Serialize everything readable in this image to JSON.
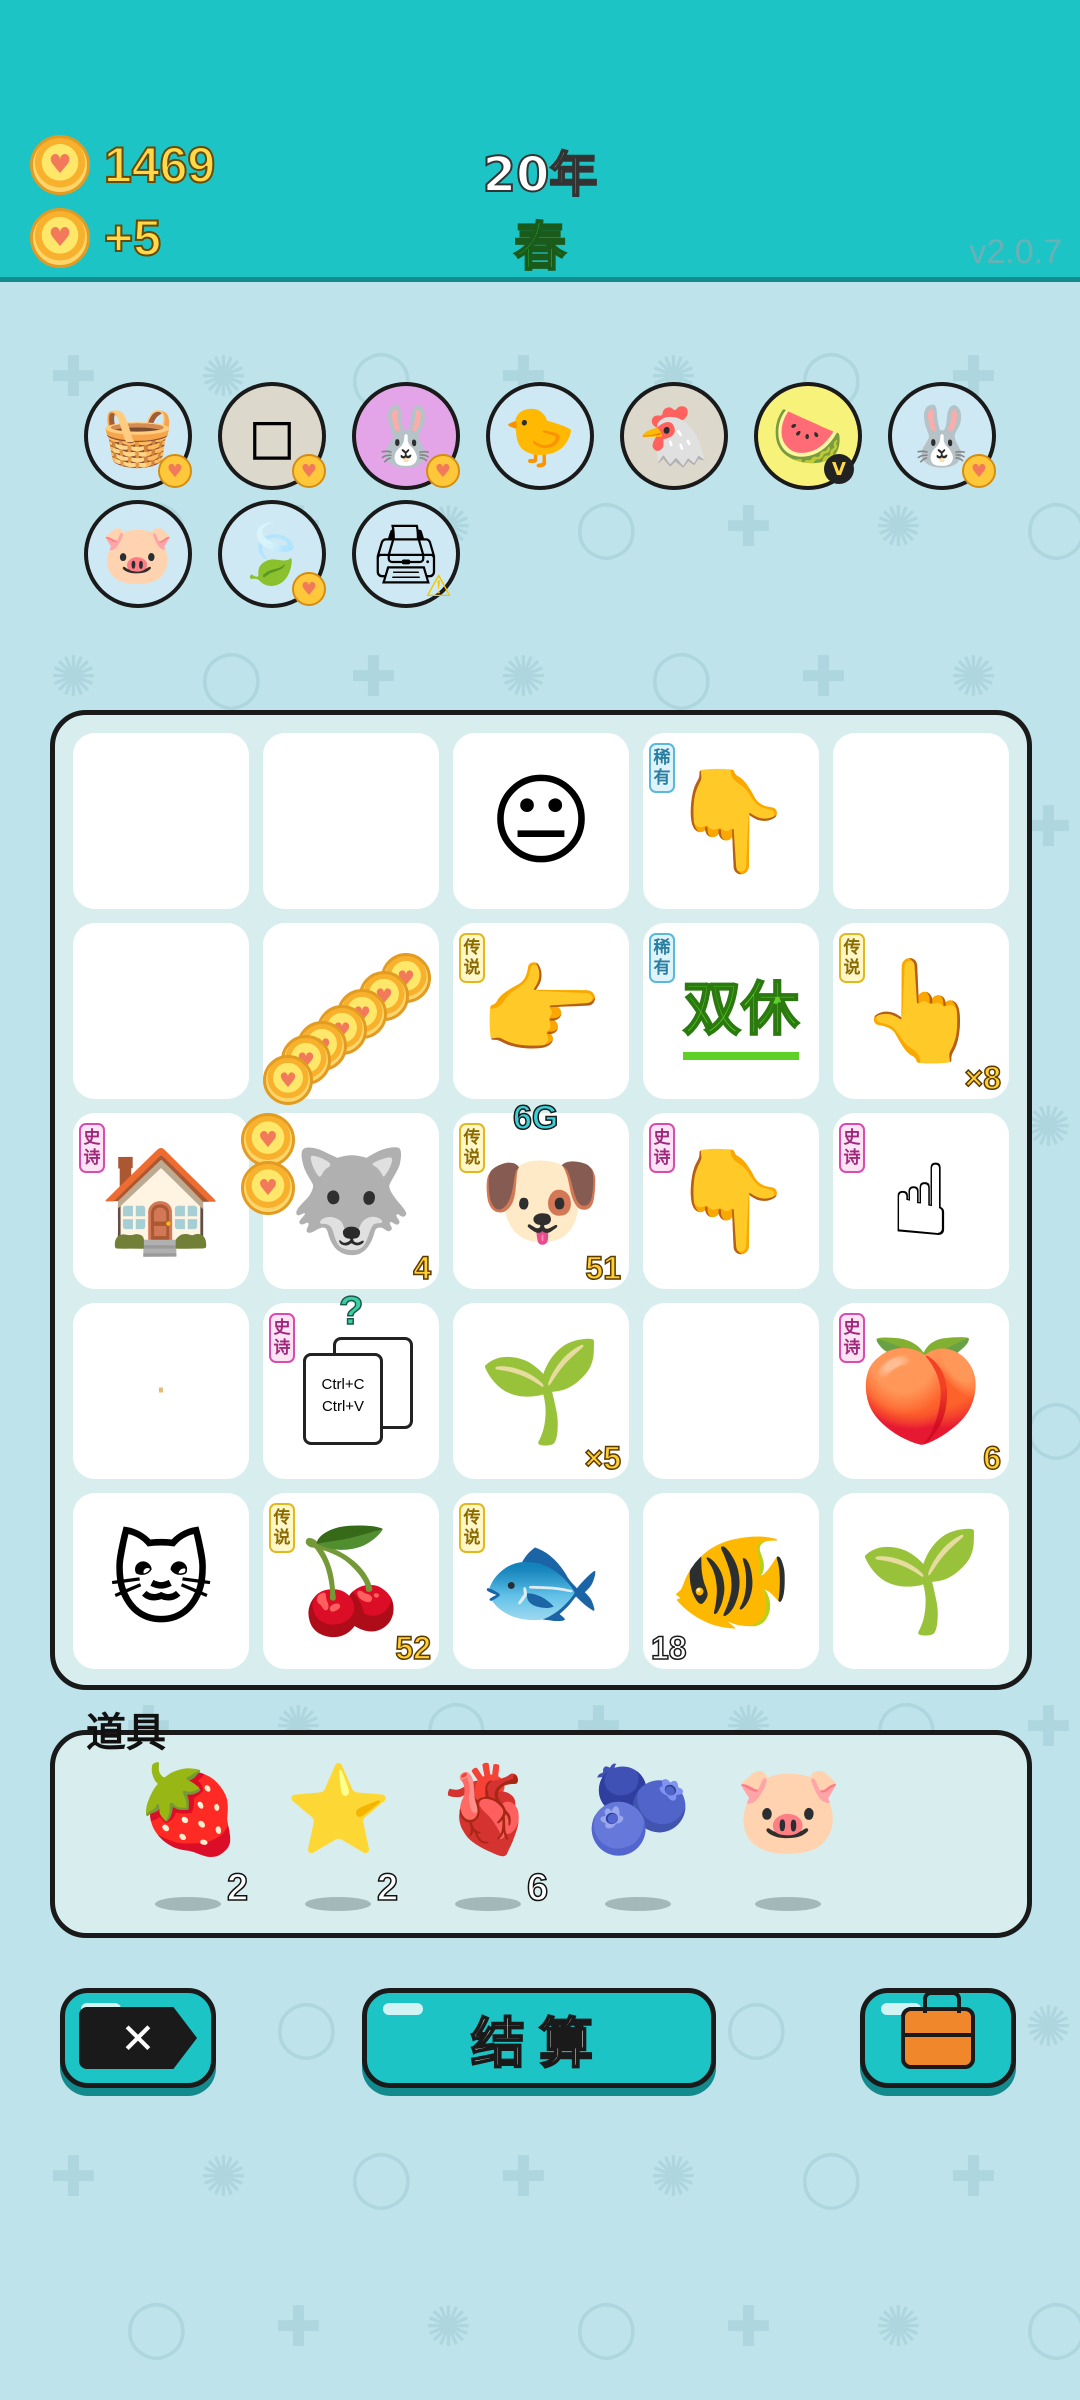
{
  "header": {
    "coins": "1469",
    "income": "+5",
    "year": "20年",
    "season": "春",
    "version": "v2.0.7",
    "coin_icon": "heart-coin-icon"
  },
  "animals": [
    {
      "name": "fruit-basket-icon",
      "glyph": "🧺",
      "bg": "#cfe9f4",
      "badge": "heart"
    },
    {
      "name": "sugar-cubes-icon",
      "glyph": "◻",
      "bg": "#ddd8cc",
      "badge": "heart"
    },
    {
      "name": "bunny-icon",
      "glyph": "🐰",
      "bg": "#e4a5e8",
      "badge": "heart"
    },
    {
      "name": "chick-with-egg-icon",
      "glyph": "🐤",
      "bg": "#cfe9f4",
      "badge": ""
    },
    {
      "name": "hen-with-egg-icon",
      "glyph": "🐔",
      "bg": "#ddd8cc",
      "badge": ""
    },
    {
      "name": "fruit-platter-icon",
      "glyph": "🍉",
      "bg": "#f7f27a",
      "badge": "v"
    },
    {
      "name": "bunny-icon",
      "glyph": "🐰",
      "bg": "#cfe9f4",
      "badge": "heart"
    },
    {
      "name": "piggy-bank-icon",
      "glyph": "🐷",
      "bg": "#cfe9f4",
      "badge": ""
    },
    {
      "name": "leaf-icon",
      "glyph": "🍃",
      "bg": "#cfe9f4",
      "badge": "heart"
    },
    {
      "name": "printer-icon",
      "glyph": "🖨",
      "bg": "#cfe9f4",
      "badge": "warn"
    }
  ],
  "board": {
    "cells": [
      {
        "name": "empty-slot",
        "glyph": "",
        "tag": "",
        "count": ""
      },
      {
        "name": "empty-slot",
        "glyph": "",
        "tag": "",
        "count": ""
      },
      {
        "name": "man-face-icon",
        "glyph": "😐",
        "tag": "",
        "count": ""
      },
      {
        "name": "brown-pointing-hand-icon",
        "glyph": "👇",
        "tag": "稀有",
        "tagType": "rare",
        "count": ""
      },
      {
        "name": "empty-slot",
        "glyph": "",
        "tag": "",
        "count": ""
      },
      {
        "name": "empty-slot",
        "glyph": "",
        "tag": "",
        "count": ""
      },
      {
        "name": "coin-stream-icon",
        "glyph": "",
        "tag": "",
        "count": ""
      },
      {
        "name": "yellow-pointing-hand-icon",
        "glyph": "👉",
        "tag": "传说",
        "tagType": "leg",
        "count": ""
      },
      {
        "name": "double-rest-icon",
        "glyph": "",
        "text": "双休",
        "tag": "稀有",
        "tagType": "rare",
        "count": ""
      },
      {
        "name": "yellow-tapping-hand-icon",
        "glyph": "👆",
        "tag": "传说",
        "tagType": "leg",
        "count": "×8"
      },
      {
        "name": "bunny-house-icon",
        "glyph": "🏠",
        "tag": "史诗",
        "tagType": "epic",
        "count": ""
      },
      {
        "name": "husky-icon",
        "glyph": "🐺",
        "tag": "",
        "count": "4"
      },
      {
        "name": "crowned-husky-icon",
        "glyph": "🐶",
        "tag": "传说",
        "tagType": "leg",
        "count": "51",
        "top": "6G"
      },
      {
        "name": "gray-pointing-hand-icon",
        "glyph": "👇",
        "tag": "史诗",
        "tagType": "epic",
        "count": ""
      },
      {
        "name": "gray-index-hand-icon",
        "glyph": "☝",
        "tag": "史诗",
        "tagType": "epic",
        "count": ""
      },
      {
        "name": "small-seed-icon",
        "glyph": "·",
        "tag": "",
        "count": ""
      },
      {
        "name": "ctrl-c-ctrl-v-icon",
        "glyph": "",
        "tag": "史诗",
        "tagType": "epic",
        "count": "",
        "clip": [
          "Ctrl+C",
          "Ctrl+V"
        ],
        "top": "?"
      },
      {
        "name": "sprout-icon",
        "glyph": "🌱",
        "tag": "",
        "count": "×5"
      },
      {
        "name": "empty-slot",
        "glyph": "",
        "tag": "",
        "count": ""
      },
      {
        "name": "peach-icon",
        "glyph": "🍑",
        "tag": "史诗",
        "tagType": "epic",
        "count": "6"
      },
      {
        "name": "yellow-cat-icon",
        "glyph": "🐱",
        "tag": "",
        "count": ""
      },
      {
        "name": "longan-icon",
        "glyph": "🍒",
        "tag": "传说",
        "tagType": "leg",
        "count": "52"
      },
      {
        "name": "koi-fish-icon",
        "glyph": "🐟",
        "tag": "传说",
        "tagType": "leg",
        "count": ""
      },
      {
        "name": "goldfish-icon",
        "glyph": "🐠",
        "tag": "",
        "count": "18",
        "countLeft": true
      },
      {
        "name": "sprout-icon",
        "glyph": "🌱",
        "tag": "",
        "count": ""
      }
    ]
  },
  "items": {
    "label": "道具",
    "list": [
      {
        "name": "lychee-icon",
        "glyph": "🍓",
        "qty": "2"
      },
      {
        "name": "star-icon",
        "glyph": "⭐",
        "qty": "2"
      },
      {
        "name": "liver-icon",
        "glyph": "🫀",
        "qty": "6"
      },
      {
        "name": "blueberry-icon",
        "glyph": "🫐",
        "qty": ""
      },
      {
        "name": "piggy-bank-icon",
        "glyph": "🐷",
        "qty": ""
      }
    ]
  },
  "buttons": {
    "exit_icon": "exit-icon",
    "settle_label": "结算",
    "bag_icon": "briefcase-icon"
  },
  "colors": {
    "header": "#1cc4c6",
    "background": "#bfe3ea",
    "coin_text": "#ffd94a",
    "season_text": "#2fc43a"
  }
}
